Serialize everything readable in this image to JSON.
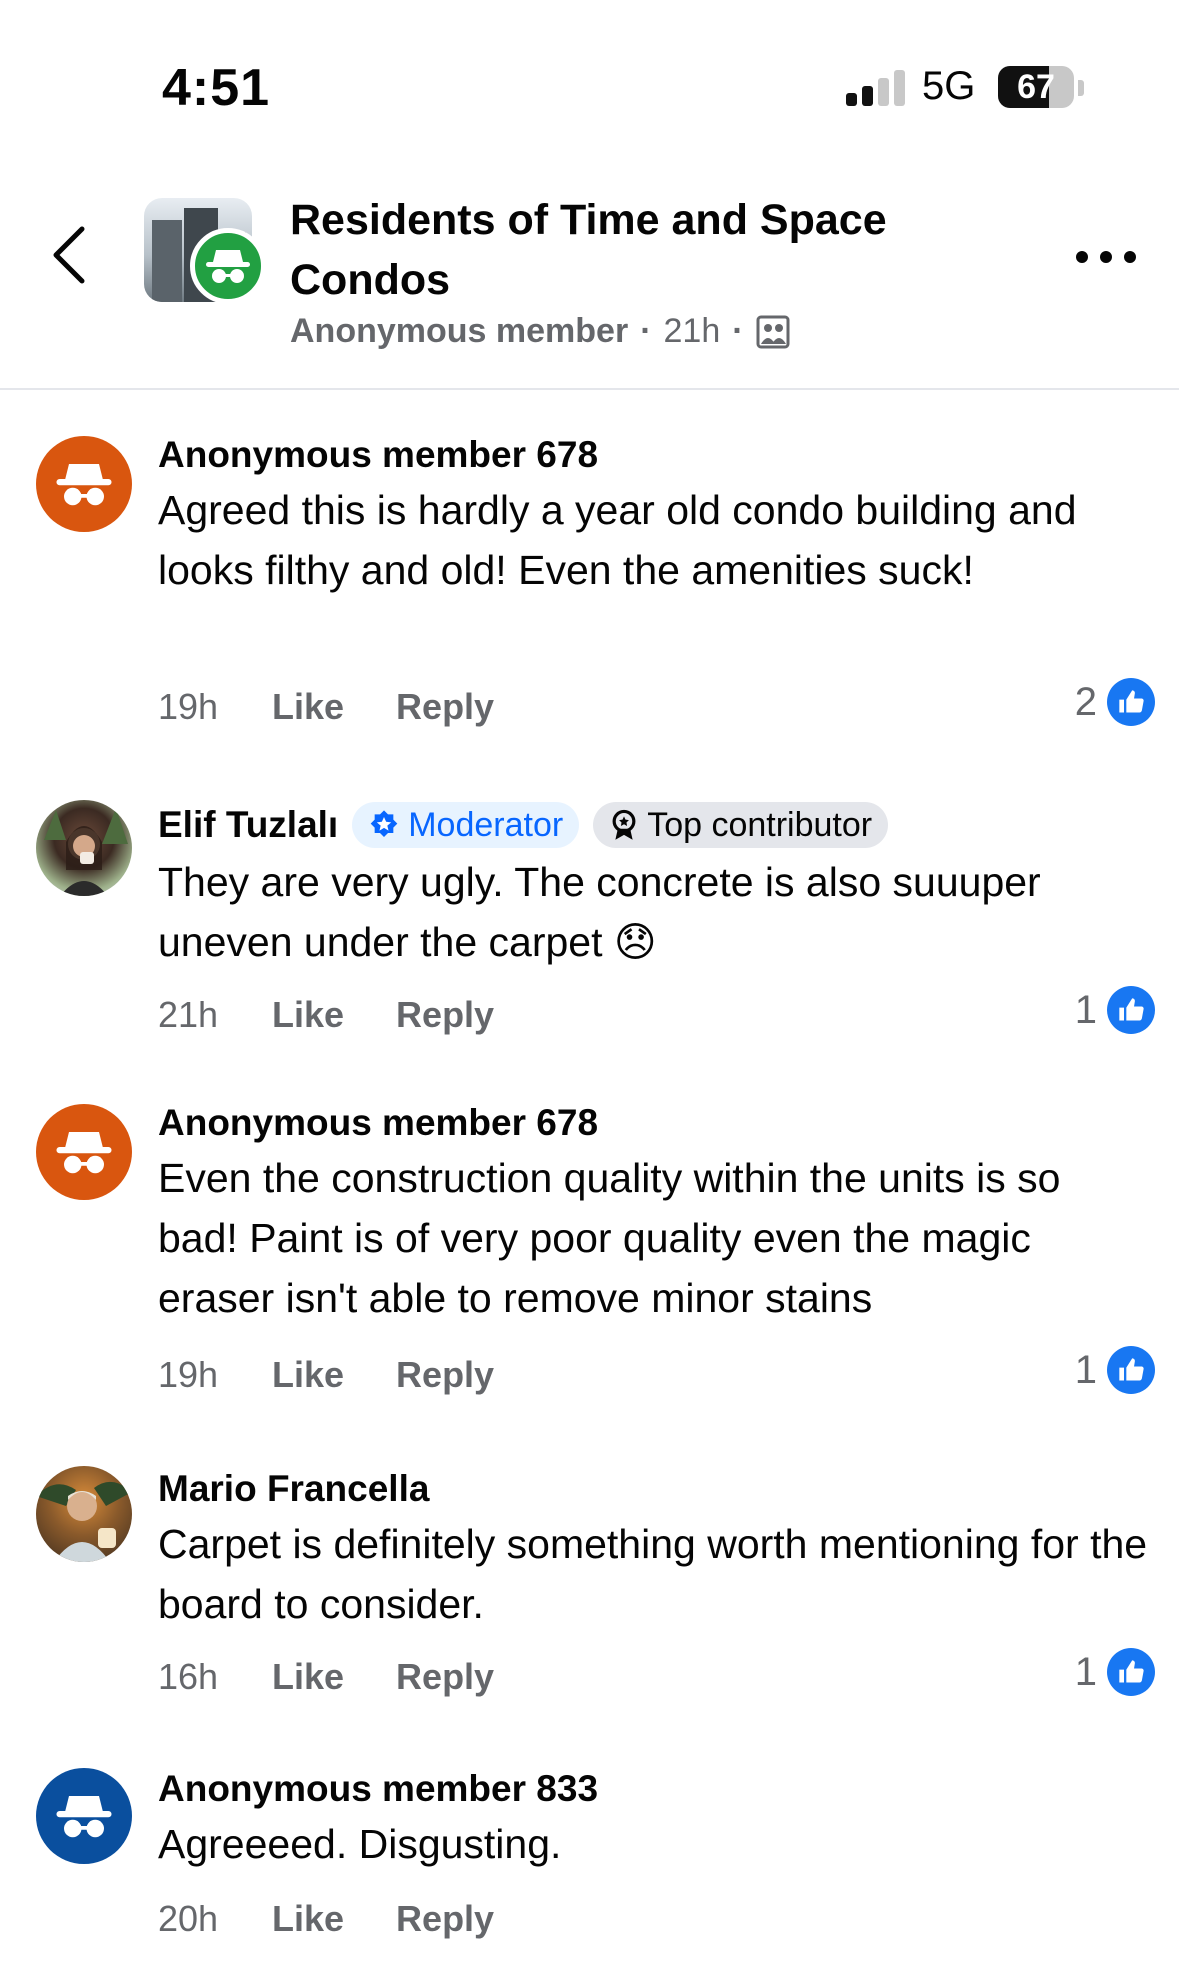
{
  "status_bar": {
    "time": "4:51",
    "network": "5G",
    "battery": "67",
    "battery_level": 0.67,
    "signal_bars": 2
  },
  "header": {
    "group_name": "Residents of Time and Space Condos",
    "poster": "Anonymous member",
    "separator": "·",
    "time": "21h",
    "separator2": "·",
    "back_icon": "chevron-left-icon",
    "more_icon": "more-horizontal-icon",
    "audience_icon": "group-members-icon"
  },
  "comments": [
    {
      "author": "Anonymous member 678",
      "avatar_color": "#d9560f",
      "text": "Agreed this is hardly a year old condo building and looks filthy and old! Even the amenities suck!",
      "time": "19h",
      "like_label": "Like",
      "reply_label": "Reply",
      "reaction_count": "2"
    },
    {
      "author": "Elif Tuzlalı",
      "badges": [
        "Moderator",
        "Top contributor"
      ],
      "text": "They are very ugly. The concrete is also suuuper uneven under the carpet 😞",
      "time": "21h",
      "like_label": "Like",
      "reply_label": "Reply",
      "reaction_count": "1"
    },
    {
      "author": "Anonymous member 678",
      "avatar_color": "#d9560f",
      "text": "Even the construction quality within the units is so bad! Paint is of very poor quality even the magic eraser isn't able to remove minor stains",
      "time": "19h",
      "like_label": "Like",
      "reply_label": "Reply",
      "reaction_count": "1"
    },
    {
      "author": "Mario Francella",
      "text": "Carpet is definitely something worth mentioning for the board to consider.",
      "time": "16h",
      "like_label": "Like",
      "reply_label": "Reply",
      "reaction_count": "1"
    },
    {
      "author": "Anonymous member 833",
      "avatar_color": "#0a4f9e",
      "text": "Agreeeed. Disgusting.",
      "time": "20h",
      "like_label": "Like",
      "reply_label": "Reply"
    }
  ],
  "colors": {
    "like_blue": "#1877f2",
    "secondary_text": "#65676b",
    "moderator_blue": "#0866ff"
  }
}
